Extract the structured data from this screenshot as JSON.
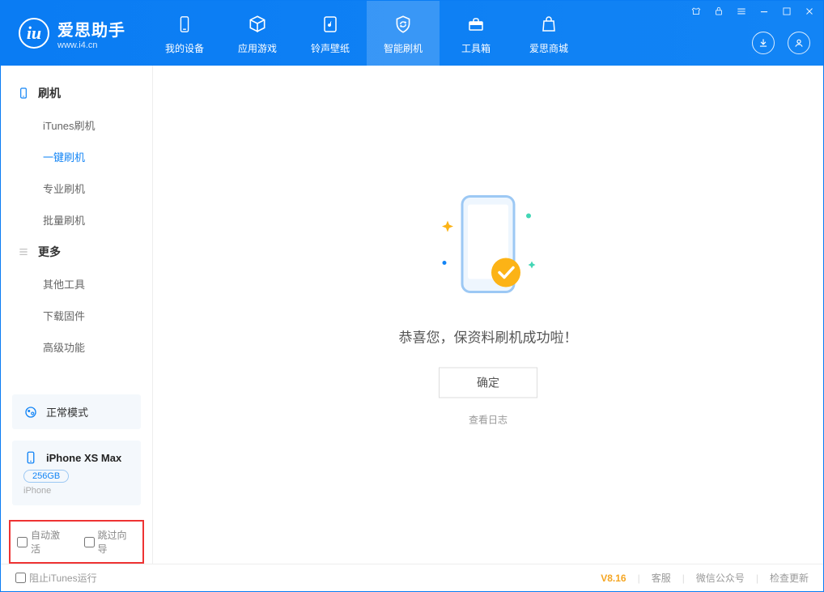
{
  "app": {
    "name": "爱思助手",
    "url": "www.i4.cn"
  },
  "tabs": [
    {
      "label": "我的设备"
    },
    {
      "label": "应用游戏"
    },
    {
      "label": "铃声壁纸"
    },
    {
      "label": "智能刷机"
    },
    {
      "label": "工具箱"
    },
    {
      "label": "爱思商城"
    }
  ],
  "sidebar": {
    "group1": {
      "title": "刷机",
      "items": [
        "iTunes刷机",
        "一键刷机",
        "专业刷机",
        "批量刷机"
      ]
    },
    "group2": {
      "title": "更多",
      "items": [
        "其他工具",
        "下载固件",
        "高级功能"
      ]
    }
  },
  "mode": "正常模式",
  "device": {
    "name": "iPhone XS Max",
    "capacity": "256GB",
    "type": "iPhone"
  },
  "options": {
    "auto_activate": "自动激活",
    "skip_guide": "跳过向导"
  },
  "main": {
    "message": "恭喜您，保资料刷机成功啦！",
    "ok": "确定",
    "view_log": "查看日志"
  },
  "footer": {
    "block_itunes": "阻止iTunes运行",
    "version": "V8.16",
    "links": [
      "客服",
      "微信公众号",
      "检查更新"
    ]
  }
}
